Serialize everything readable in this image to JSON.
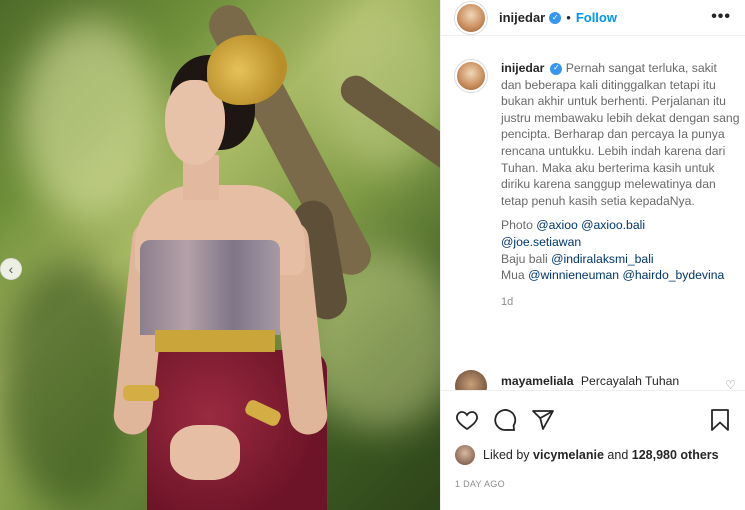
{
  "post": {
    "username": "inijedar",
    "follow_label": "Follow",
    "more_label": "•••",
    "carousel_prev": "‹",
    "caption": "Pernah sangat terluka, sakit dan beberapa kali ditinggalkan tetapi itu bukan akhir untuk berhenti. Perjalanan itu justru membawaku lebih dekat dengan sang pencipta. Berharap dan percaya Ia punya rencana untukku. Lebih indah karena dari Tuhan. Maka aku berterima kasih untuk diriku karena sanggup melewatinya dan tetap penuh kasih setia kepadaNya.",
    "credits": {
      "photo_label": "Photo",
      "photo_mention_1": "@axioo",
      "photo_mention_2": "@axioo.bali",
      "photo_mention_3": "@joe.setiawan",
      "baju_label": "Baju bali",
      "baju_mention": "@indiralaksmi_bali",
      "mua_label": "Mua",
      "mua_mention_1": "@winnieneuman",
      "mua_mention_2": "@hairdo_bydevina"
    },
    "caption_time": "1d",
    "comment": {
      "username": "mayameliala",
      "text": "Percayalah Tuhan"
    },
    "likes": {
      "prefix": "Liked by",
      "user": "vicymelanie",
      "and": "and",
      "count": "128,980 others"
    },
    "posted_ago": "1 DAY AGO"
  },
  "icons": [
    "heart-icon",
    "comment-icon",
    "share-icon",
    "bookmark-icon",
    "verified-icon",
    "more-icon"
  ],
  "colors": {
    "link": "#0095f6",
    "mention": "#00376b",
    "verified": "#3897f0"
  }
}
